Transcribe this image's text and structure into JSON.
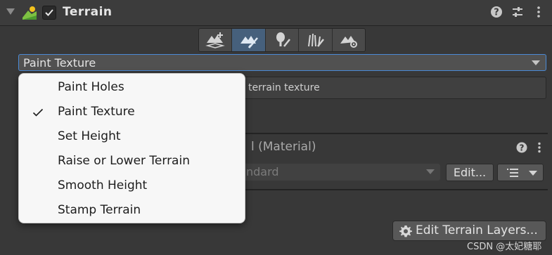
{
  "component": {
    "title": "Terrain",
    "enabled": true
  },
  "header_icons": [
    "help-icon",
    "presets-sliders-icon",
    "kebab-menu-icon"
  ],
  "toolbar": {
    "tools": [
      {
        "name": "create-neighbor-terrains-icon",
        "active": false
      },
      {
        "name": "paint-terrain-icon",
        "active": true
      },
      {
        "name": "paint-trees-icon",
        "active": false
      },
      {
        "name": "paint-details-icon",
        "active": false
      },
      {
        "name": "terrain-settings-icon",
        "active": false
      }
    ]
  },
  "tool_select": {
    "value": "Paint Texture"
  },
  "help_box": {
    "text": "terrain texture"
  },
  "material": {
    "title": "l (Material)",
    "shader_value": "ndard",
    "edit_label": "Edit...",
    "edit_layers_label": "Edit Terrain Layers..."
  },
  "menu": {
    "items": [
      {
        "label": "Paint Holes",
        "checked": false
      },
      {
        "label": "Paint Texture",
        "checked": true
      },
      {
        "label": "Set Height",
        "checked": false
      },
      {
        "label": "Raise or Lower Terrain",
        "checked": false
      },
      {
        "label": "Smooth Height",
        "checked": false
      },
      {
        "label": "Stamp Terrain",
        "checked": false
      }
    ]
  },
  "watermark": "CSDN @太妃糖耶",
  "colors": {
    "background": "#383838",
    "active_tool": "#46607c",
    "focus_border": "#4a8ad6",
    "menu_bg": "#f7f7f7"
  }
}
